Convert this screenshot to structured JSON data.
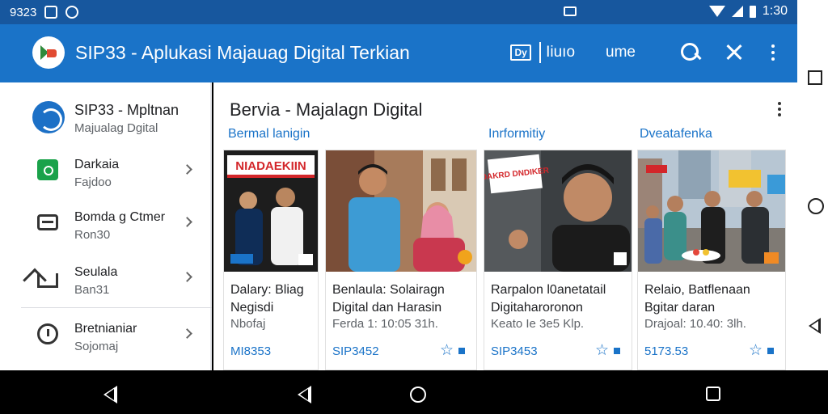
{
  "status_bar": {
    "left_text": "9323",
    "time": "1:30"
  },
  "app_bar": {
    "title": "SIP33 - Aplukasi Majauag Digital Terkian",
    "action_brand": "Dy",
    "action_one": "Iiuıo",
    "action_two": "ume",
    "search_icon": "search-icon",
    "tools_icon": "tools-icon",
    "more_icon": "more-vert-icon"
  },
  "drawer": {
    "profile": {
      "name": "SIP33 - Mpltnan",
      "subtitle": "Majualag Dgital"
    },
    "items": [
      {
        "title": "Darkaia",
        "subtitle": "Fajdoo",
        "icon": "bag-icon"
      },
      {
        "title": "Bomda g Ctmer",
        "subtitle": "Ron30",
        "icon": "card-icon"
      },
      {
        "title": "Seulala",
        "subtitle": "Ban31",
        "icon": "home-icon"
      },
      {
        "title": "Bretnianiar",
        "subtitle": "Sojomaj",
        "icon": "clock-icon"
      }
    ]
  },
  "main": {
    "title": "Bervia - Majalagn Digital",
    "tabs": [
      "Bermal lanigin",
      "Inrformitiy",
      "Dveatafenka"
    ],
    "cards": [
      {
        "title": "Dalary: Bliag Negisdi",
        "meta": "Nbofaj",
        "code": "MI8353",
        "badge_text": "NIADAEKIIN"
      },
      {
        "title": "Benlaula: Solairagn Digital dan Harasin",
        "meta": "Ferda 1: 10:05 31h.",
        "code": "SIP3452",
        "badge_text": ""
      },
      {
        "title": "Rarpalon l0anetatail Digitaharoronon",
        "meta": "Keato Ie 3e5 Klp.",
        "code": "SIP3453",
        "badge_text": "DAKRD DNDIKER"
      },
      {
        "title": "Relaio, Batflenaan Bgitar daran",
        "meta": "Drajoal: 10.40: 3lh.",
        "code": "5173.53",
        "badge_text": ""
      }
    ]
  },
  "colors": {
    "primary": "#1a73c8",
    "status_bar": "#17579e",
    "drawer_green": "#1aa24a"
  }
}
